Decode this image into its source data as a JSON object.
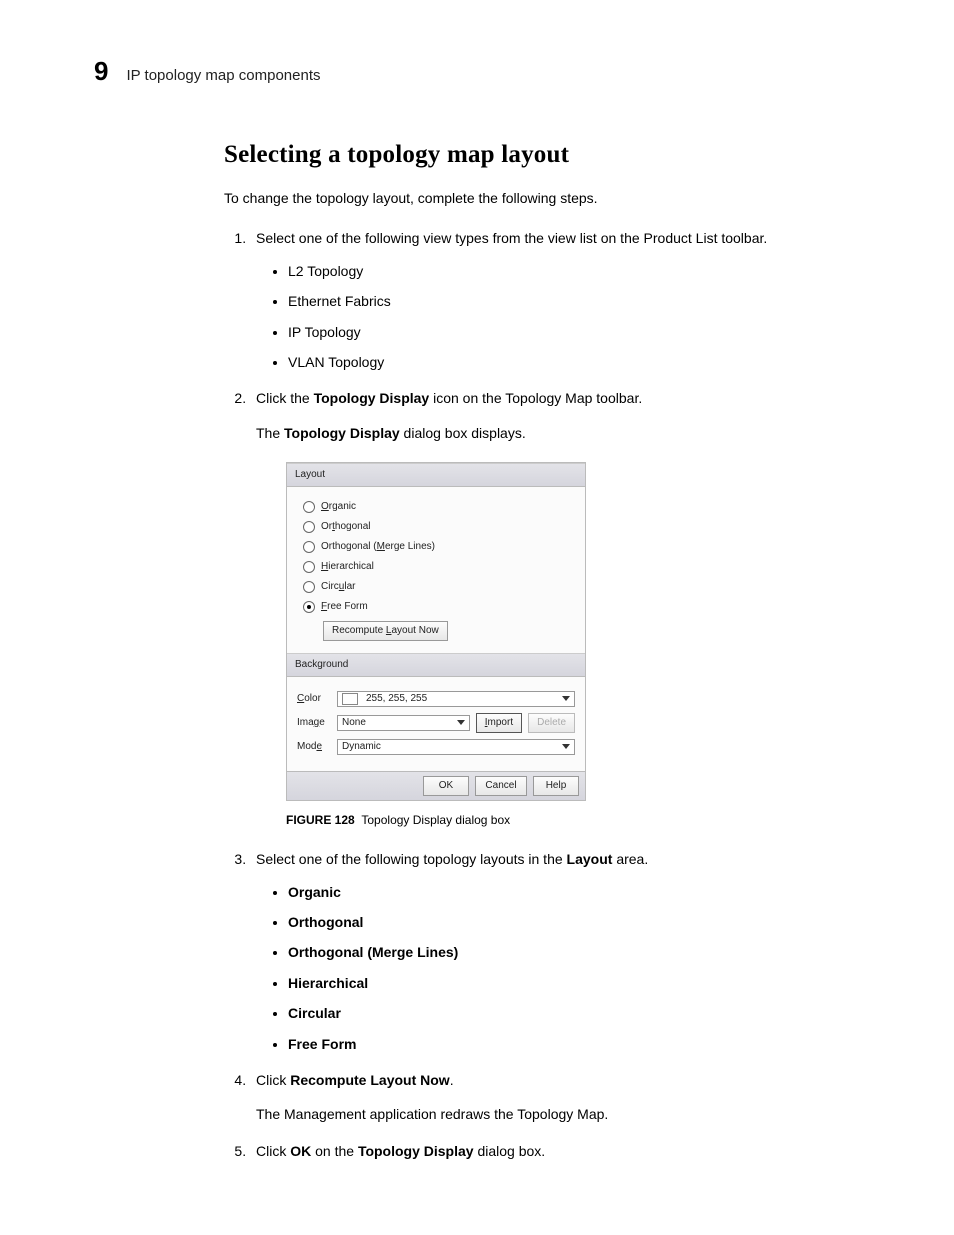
{
  "header": {
    "chapter_number": "9",
    "chapter_title": "IP topology map components"
  },
  "section": {
    "title": "Selecting a topology map layout",
    "intro": "To change the topology layout, complete the following steps."
  },
  "steps": {
    "s1_text": "Select one of the following view types from the view list on the Product List toolbar.",
    "s1_bullets": [
      "L2 Topology",
      "Ethernet Fabrics",
      "IP Topology",
      "VLAN Topology"
    ],
    "s2_prefix": "Click the ",
    "s2_bold": "Topology Display",
    "s2_suffix": " icon on the Topology Map toolbar.",
    "s2_after_prefix": "The ",
    "s2_after_bold": "Topology Display",
    "s2_after_suffix": " dialog box displays.",
    "s3_text": "Select one of the following topology layouts in the ",
    "s3_bold": "Layout",
    "s3_suffix": " area.",
    "s3_bullets": [
      "Organic",
      "Orthogonal",
      "Orthogonal (Merge Lines)",
      "Hierarchical",
      "Circular",
      "Free Form"
    ],
    "s4_prefix": "Click ",
    "s4_bold": "Recompute Layout Now",
    "s4_suffix": ".",
    "s4_after": "The Management application redraws the Topology Map.",
    "s5_prefix": "Click ",
    "s5_bold1": "OK",
    "s5_mid": " on the ",
    "s5_bold2": "Topology Display",
    "s5_suffix": " dialog box."
  },
  "figure": {
    "label": "FIGURE 128",
    "caption": "Topology Display dialog box"
  },
  "dialog": {
    "layout_header": "Layout",
    "radios": [
      {
        "label": "Organic",
        "underline": "O",
        "rest": "rganic",
        "selected": false
      },
      {
        "label": "Orthogonal",
        "underline": "",
        "pre": "Or",
        "u": "t",
        "rest": "hogonal",
        "selected": false
      },
      {
        "label": "Orthogonal (Merge Lines)",
        "pre": "Orthogonal (",
        "u": "M",
        "rest": "erge Lines)",
        "selected": false
      },
      {
        "label": "Hierarchical",
        "u": "H",
        "rest": "ierarchical",
        "pre": "",
        "selected": false
      },
      {
        "label": "Circular",
        "pre": "Circ",
        "u": "u",
        "rest": "lar",
        "selected": false
      },
      {
        "label": "Free Form",
        "u": "F",
        "rest": "ree Form",
        "pre": "",
        "selected": true
      }
    ],
    "recompute_pre": "Recompute ",
    "recompute_u": "L",
    "recompute_rest": "ayout Now",
    "background_header": "Background",
    "color_label_u": "C",
    "color_label_rest": "olor",
    "color_value": "255, 255, 255",
    "image_label_pre": "Ima",
    "image_label_u": "g",
    "image_label_rest": "e",
    "image_value": "None",
    "import_u": "I",
    "import_rest": "mport",
    "delete_label": "Delete",
    "mode_label_pre": "Mod",
    "mode_label_u": "e",
    "mode_value": "Dynamic",
    "ok": "OK",
    "cancel": "Cancel",
    "help": "Help"
  }
}
